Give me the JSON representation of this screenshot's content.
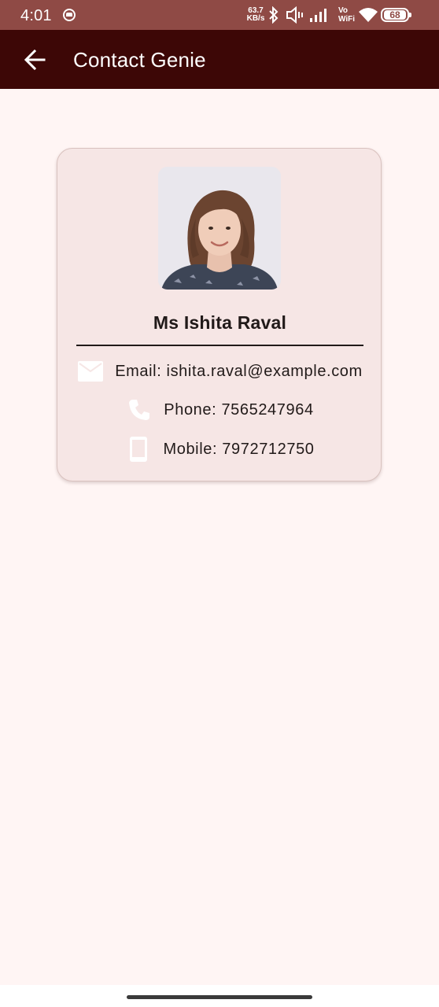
{
  "status_bar": {
    "time": "4:01",
    "net_speed_value": "63.7",
    "net_speed_unit": "KB/s",
    "vowifi_top": "Vo",
    "vowifi_bottom": "WiFi",
    "battery": "68",
    "icons": [
      "app-notification-icon",
      "bluetooth-icon",
      "vibrate-icon",
      "signal-icon",
      "wifi-icon",
      "battery-icon"
    ]
  },
  "app_bar": {
    "title": "Contact Genie",
    "back_icon": "arrow-back-icon"
  },
  "contact": {
    "name": "Ms Ishita Raval",
    "email_text": "Email: ishita.raval@example.com",
    "phone_text": "Phone: 7565247964",
    "mobile_text": "Mobile: 7972712750",
    "icons": {
      "email": "email-icon",
      "phone": "phone-icon",
      "mobile": "mobile-phone-icon"
    }
  },
  "colors": {
    "status_bar": "#8f4a45",
    "app_bar": "#3d0706",
    "background": "#fff5f4",
    "card": "#f6e6e5",
    "text": "#211a19"
  }
}
